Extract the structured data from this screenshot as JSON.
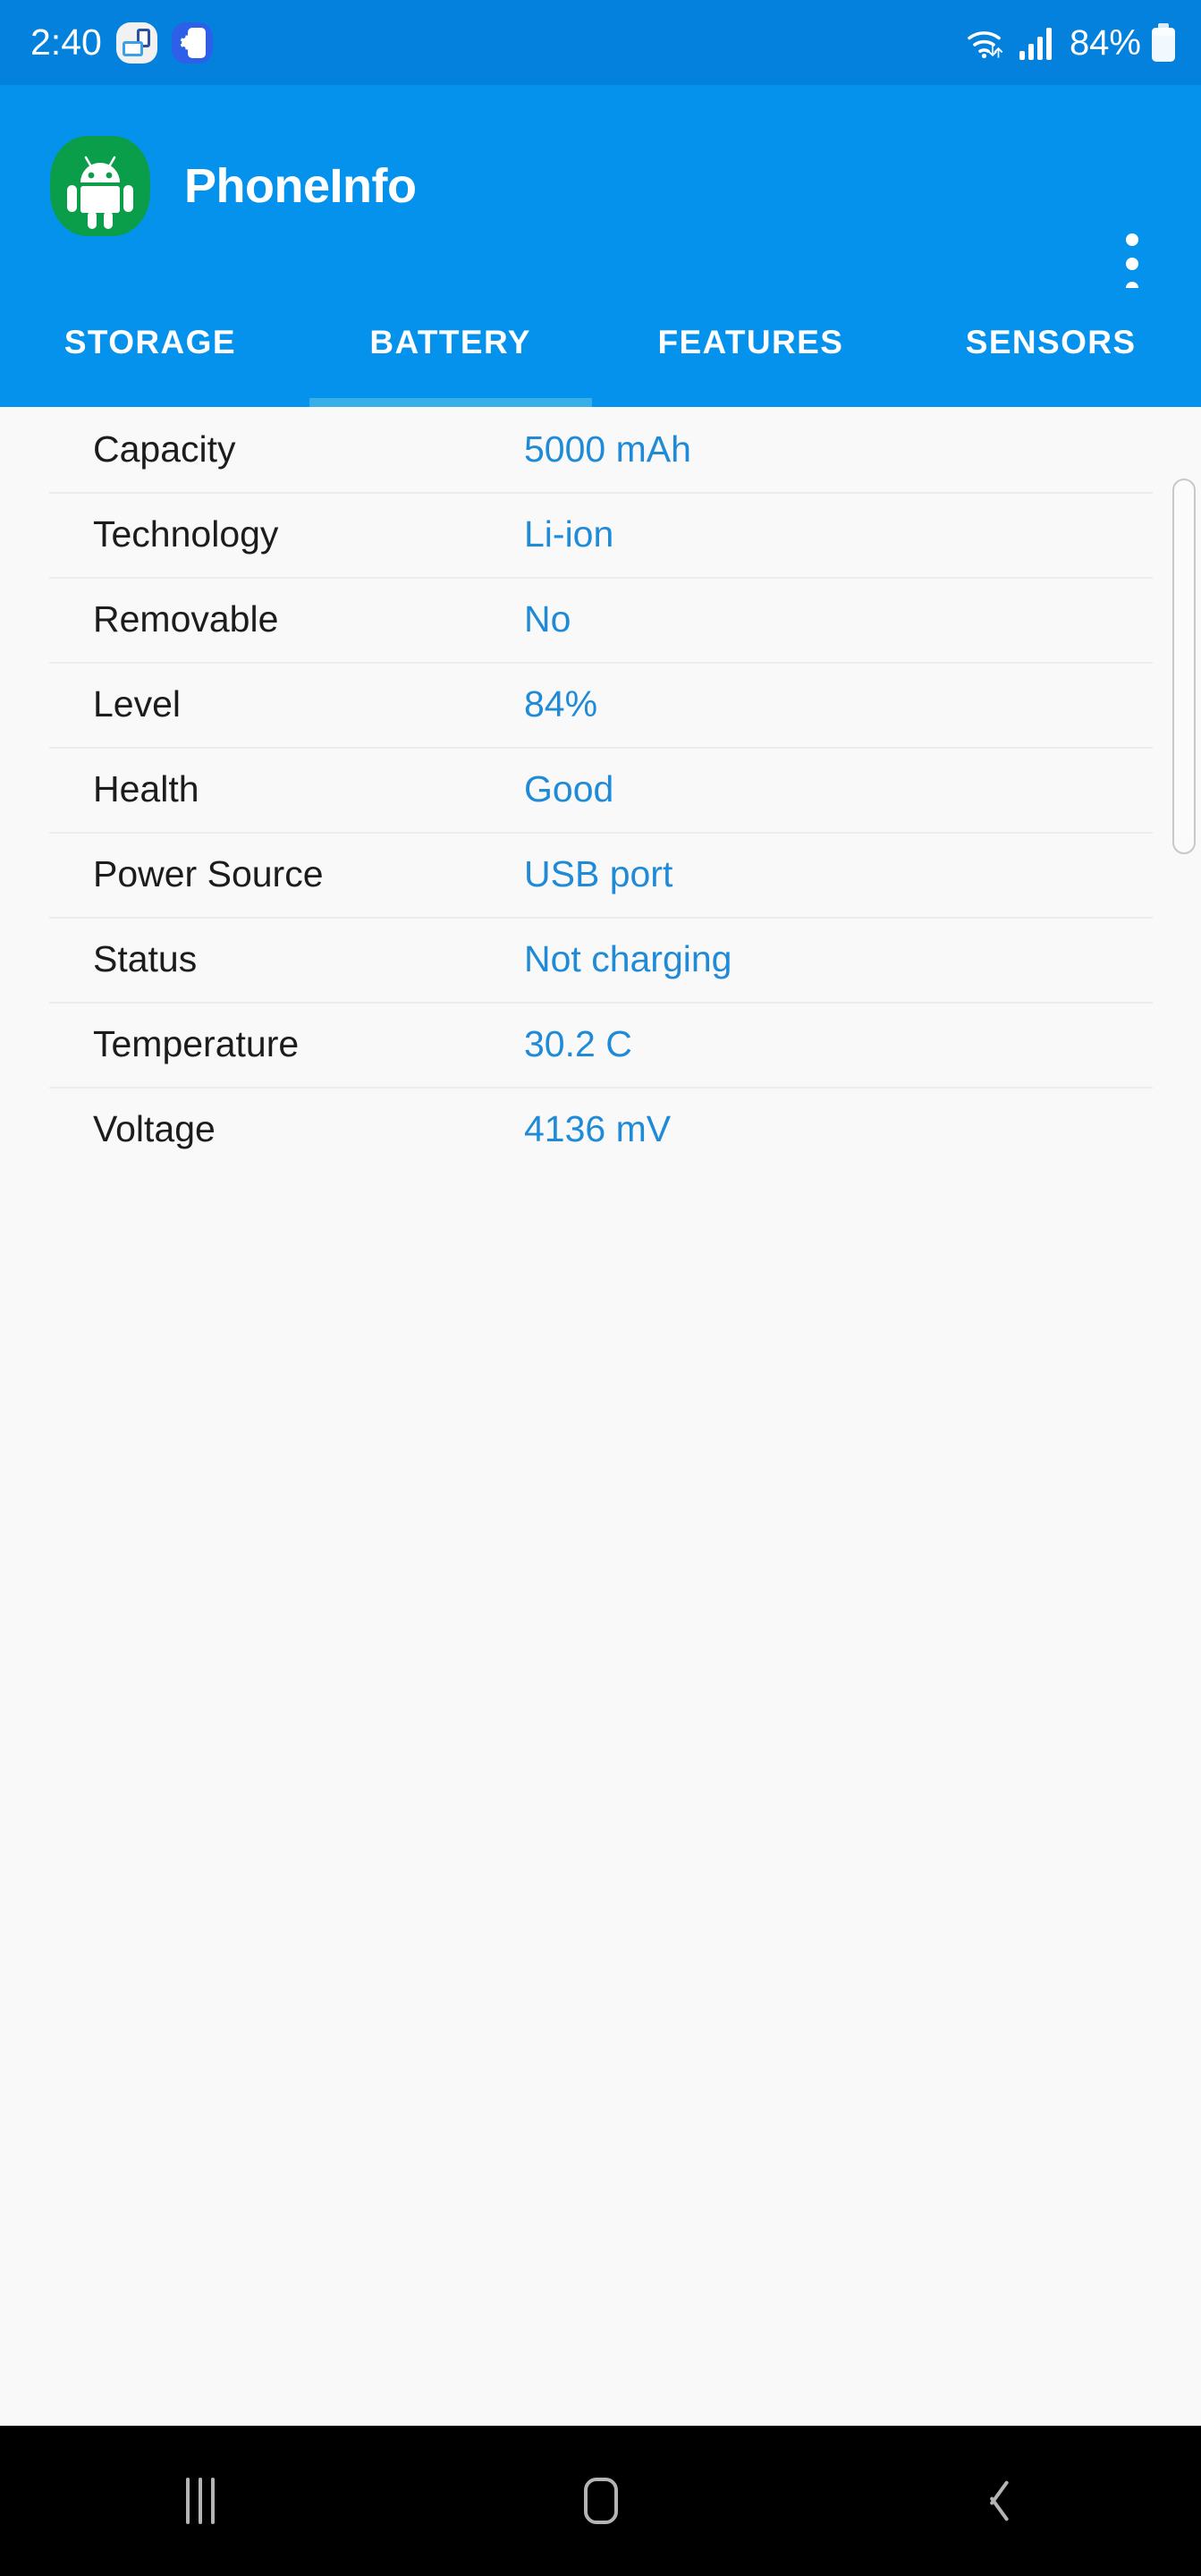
{
  "status_bar": {
    "clock": "2:40",
    "battery_percent": "84%",
    "icons": {
      "notification_cast": "screen-cast-icon",
      "notification_device_settings": "device-settings-icon",
      "wifi": "wifi-icon",
      "signal": "cellular-signal-icon",
      "battery": "battery-icon"
    },
    "background_color": "#0381dc"
  },
  "app_bar": {
    "title": "PhoneInfo",
    "icon": "android-robot-icon",
    "overflow_menu": "more-options-icon",
    "background_color": "#0592ec",
    "icon_background_color": "#0a9d4a"
  },
  "tabs": {
    "items": [
      {
        "label": "STORAGE",
        "active": false
      },
      {
        "label": "BATTERY",
        "active": true
      },
      {
        "label": "FEATURES",
        "active": false
      },
      {
        "label": "SENSORS",
        "active": false
      }
    ],
    "indicator_color": "#37b0e8"
  },
  "battery_info": {
    "rows": [
      {
        "label": "Capacity",
        "value": "5000 mAh"
      },
      {
        "label": "Technology",
        "value": "Li-ion"
      },
      {
        "label": "Removable",
        "value": "No"
      },
      {
        "label": "Level",
        "value": "84%"
      },
      {
        "label": "Health",
        "value": "Good"
      },
      {
        "label": "Power Source",
        "value": "USB port"
      },
      {
        "label": "Status",
        "value": "Not charging"
      },
      {
        "label": "Temperature",
        "value": "30.2 C"
      },
      {
        "label": "Voltage",
        "value": "4136 mV"
      }
    ],
    "label_color": "#1c1c1c",
    "value_color": "#1f8bd8",
    "background_color": "#f9f9f9"
  },
  "nav_bar": {
    "buttons": [
      {
        "name": "recents",
        "glyph": "recents-icon"
      },
      {
        "name": "home",
        "glyph": "home-icon"
      },
      {
        "name": "back",
        "glyph": "back-icon"
      }
    ],
    "background_color": "#000000"
  }
}
